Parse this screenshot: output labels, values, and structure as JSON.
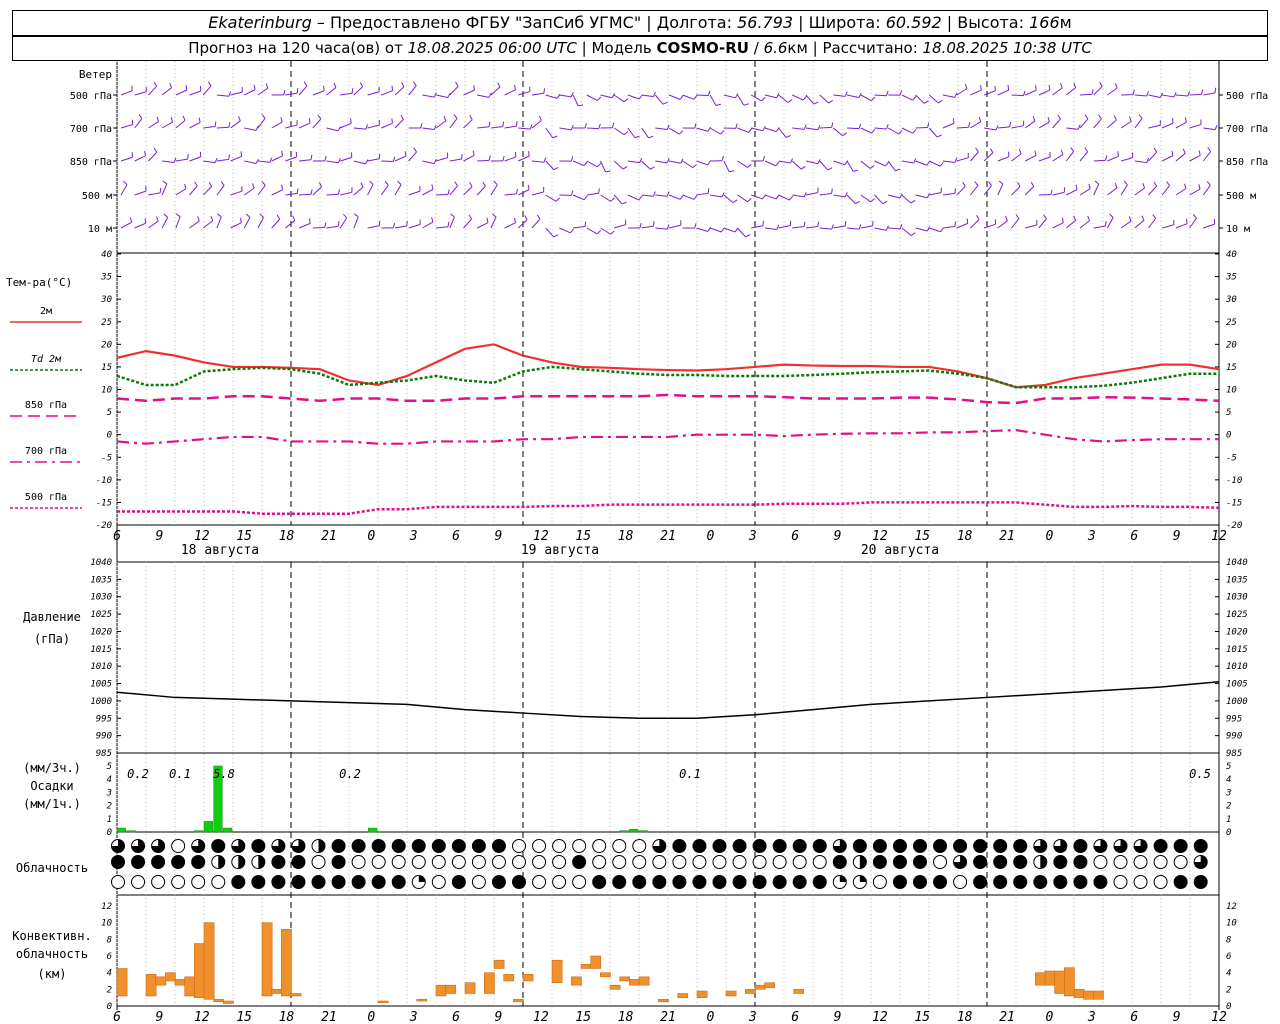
{
  "header": {
    "city": "Ekaterinburg",
    "dash": "–",
    "provider": "Предоставлено ФГБУ \"ЗапСиб УГМС\"",
    "lon_label": "Долгота:",
    "lon": "56.793",
    "lat_label": "Широта:",
    "lat": "60.592",
    "alt_label": "Высота:",
    "alt": "166",
    "alt_unit": "м",
    "forecast_prefix": "Прогноз на 120 часа(ов) от",
    "forecast_start": "18.08.2025 06:00 UTC",
    "model_label": "Модель",
    "model": "COSMO-RU",
    "model_res": "6.6",
    "model_res_unit": "км",
    "computed_label": "Рассчитано:",
    "computed": "18.08.2025 10:38 UTC",
    "sep": "|",
    "slash": "/"
  },
  "panels": {
    "wind": {
      "title": "Ветер",
      "levels": [
        "500 гПа",
        "700 гПа",
        "850 гПа",
        "500 м",
        "10 м"
      ],
      "color": "#7a1fd6"
    },
    "temp": {
      "title": "Тем-ра(°С)",
      "legend": [
        "2м",
        "Td 2м",
        "850 гПа",
        "700 гПа",
        "500 гПа"
      ],
      "yticks": [
        "40",
        "35",
        "30",
        "25",
        "20",
        "15",
        "10",
        "5",
        "0",
        "-5",
        "-10",
        "-15",
        "-20"
      ]
    },
    "pressure": {
      "title1": "Давление",
      "title2": "(гПа)",
      "yticks": [
        "1040",
        "1035",
        "1030",
        "1025",
        "1020",
        "1015",
        "1010",
        "1005",
        "1000",
        "995",
        "990",
        "985"
      ]
    },
    "precip": {
      "title1": "(мм/3ч.)",
      "title2": "Осадки",
      "title3": "(мм/1ч.)",
      "yticks": [
        "5",
        "4",
        "3",
        "2",
        "1",
        "0"
      ],
      "totals": [
        "0.2",
        "0.1",
        "5.8",
        "0.2",
        "0.1",
        "0.5"
      ]
    },
    "cloud": {
      "title": "Облачность"
    },
    "conv": {
      "title1": "Конвективн.",
      "title2": "облачность",
      "title3": "(км)",
      "yticks": [
        "12",
        "10",
        "8",
        "6",
        "4",
        "2",
        "0"
      ]
    }
  },
  "time_axis": {
    "hour_labels": [
      "6",
      "9",
      "12",
      "15",
      "18",
      "21",
      "0",
      "3",
      "6",
      "9",
      "12",
      "15",
      "18",
      "21",
      "0",
      "3",
      "6",
      "9",
      "12",
      "15",
      "18",
      "21",
      "0",
      "3",
      "6",
      "9",
      "12"
    ],
    "day_labels": [
      "18 августа",
      "19 августа",
      "20 августа"
    ]
  },
  "chart_data": {
    "type": "line",
    "x_unit": "hours since 18.08.2025 06:00 UTC",
    "temperature": {
      "ylim": [
        -20,
        40
      ],
      "series": [
        {
          "name": "2м",
          "color": "#f03030",
          "style": "solid",
          "x": [
            0,
            3,
            6,
            9,
            12,
            15,
            18,
            21,
            24,
            27,
            30,
            33,
            36,
            39,
            42,
            45,
            48,
            51,
            54,
            57,
            60,
            63,
            66,
            69,
            72,
            75,
            78,
            81,
            84,
            87,
            90,
            93,
            96,
            99,
            102,
            105,
            108,
            111,
            114
          ],
          "values": [
            17,
            18.5,
            17.5,
            16,
            15,
            15,
            14.8,
            14.5,
            12,
            11,
            13,
            16,
            19,
            20,
            17.5,
            16,
            15,
            14.8,
            14.5,
            14.3,
            14.2,
            14.5,
            15,
            15.5,
            15.3,
            15.2,
            15.2,
            15,
            15,
            14,
            12.5,
            10.5,
            11,
            12.5,
            13.5,
            14.5,
            15.5,
            15.5,
            14.5
          ]
        },
        {
          "name": "Td 2м",
          "color": "#0a7a0a",
          "style": "dot",
          "x": [
            0,
            3,
            6,
            9,
            12,
            15,
            18,
            21,
            24,
            27,
            30,
            33,
            36,
            39,
            42,
            45,
            48,
            51,
            54,
            57,
            60,
            63,
            66,
            69,
            72,
            75,
            78,
            81,
            84,
            87,
            90,
            93,
            96,
            99,
            102,
            105,
            108,
            111,
            114
          ],
          "values": [
            13,
            11,
            11,
            14,
            14.5,
            14.8,
            14.5,
            13.5,
            11,
            11.5,
            12,
            13,
            12,
            11.5,
            14,
            15,
            14.5,
            14,
            13.5,
            13.2,
            13.2,
            13,
            13,
            13,
            13.2,
            13.5,
            13.8,
            14,
            14.2,
            13.5,
            12.5,
            10.5,
            10.5,
            10.5,
            10.8,
            11.5,
            12.5,
            13.5,
            13.5
          ]
        },
        {
          "name": "850 гПа",
          "color": "#e0108a",
          "style": "dash",
          "x": [
            0,
            3,
            6,
            9,
            12,
            15,
            18,
            21,
            24,
            27,
            30,
            33,
            36,
            39,
            42,
            45,
            48,
            51,
            54,
            57,
            60,
            63,
            66,
            69,
            72,
            75,
            78,
            81,
            84,
            87,
            90,
            93,
            96,
            99,
            102,
            105,
            108,
            111,
            114
          ],
          "values": [
            8,
            7.5,
            8,
            8,
            8.5,
            8.5,
            8,
            7.5,
            8,
            8,
            7.5,
            7.5,
            8,
            8,
            8.5,
            8.5,
            8.5,
            8.5,
            8.5,
            8.8,
            8.5,
            8.5,
            8.5,
            8.3,
            8,
            8,
            8,
            8.2,
            8.2,
            7.8,
            7.2,
            7,
            8,
            8,
            8.3,
            8.2,
            8,
            7.8,
            7.5
          ]
        },
        {
          "name": "700 гПа",
          "color": "#e0108a",
          "style": "dashdot",
          "x": [
            0,
            3,
            6,
            9,
            12,
            15,
            18,
            21,
            24,
            27,
            30,
            33,
            36,
            39,
            42,
            45,
            48,
            51,
            54,
            57,
            60,
            63,
            66,
            69,
            72,
            75,
            78,
            81,
            84,
            87,
            90,
            93,
            96,
            99,
            102,
            105,
            108,
            111,
            114
          ],
          "values": [
            -1.5,
            -2,
            -1.5,
            -1,
            -0.5,
            -0.5,
            -1.5,
            -1.5,
            -1.5,
            -2,
            -2,
            -1.5,
            -1.5,
            -1.5,
            -1,
            -1,
            -0.5,
            -0.5,
            -0.5,
            -0.5,
            0,
            0,
            0,
            -0.3,
            0,
            0.2,
            0.3,
            0.3,
            0.5,
            0.5,
            0.8,
            1,
            0,
            -1,
            -1.5,
            -1.2,
            -1,
            -1,
            -1
          ]
        },
        {
          "name": "500 гПа",
          "color": "#e0108a",
          "style": "dot",
          "x": [
            0,
            3,
            6,
            9,
            12,
            15,
            18,
            21,
            24,
            27,
            30,
            33,
            36,
            39,
            42,
            45,
            48,
            51,
            54,
            57,
            60,
            63,
            66,
            69,
            72,
            75,
            78,
            81,
            84,
            87,
            90,
            93,
            96,
            99,
            102,
            105,
            108,
            111,
            114
          ],
          "values": [
            -17,
            -17,
            -17,
            -17,
            -17,
            -17.5,
            -17.5,
            -17.5,
            -17.5,
            -16.5,
            -16.5,
            -16,
            -16,
            -16,
            -16,
            -15.8,
            -15.8,
            -15.5,
            -15.5,
            -15.5,
            -15.5,
            -15.5,
            -15.5,
            -15.3,
            -15.3,
            -15.3,
            -15,
            -15,
            -15,
            -15,
            -15,
            -15,
            -15.5,
            -16,
            -16,
            -15.8,
            -16,
            -16,
            -16.2
          ]
        }
      ]
    },
    "pressure": {
      "ylim": [
        985,
        1040
      ],
      "series": [
        {
          "name": "p",
          "color": "#000000",
          "x": [
            0,
            6,
            12,
            18,
            24,
            30,
            36,
            42,
            48,
            54,
            60,
            66,
            72,
            78,
            84,
            90,
            96,
            102,
            108,
            114
          ],
          "values": [
            1002.5,
            1001,
            1000.5,
            1000,
            999.5,
            999,
            997.5,
            996.5,
            995.5,
            995,
            995,
            996,
            997.5,
            999,
            1000,
            1001,
            1002,
            1003,
            1004,
            1005.5
          ]
        }
      ]
    },
    "precip": {
      "ylim": [
        0,
        5
      ],
      "color": "#11cc11",
      "x": [
        0,
        1,
        2,
        3,
        6,
        7,
        8,
        9,
        10,
        11,
        12,
        13,
        14,
        24,
        25,
        26,
        27,
        28,
        29,
        30,
        31,
        32,
        33,
        34,
        35,
        36,
        37,
        38,
        39,
        40,
        41,
        42,
        43,
        44,
        45,
        46,
        47,
        48,
        49,
        50,
        51,
        52,
        53,
        54,
        55,
        56,
        57,
        58,
        59,
        60,
        61,
        62,
        63,
        64,
        65,
        66,
        67,
        68,
        69,
        70,
        71,
        72,
        73,
        74,
        75,
        76,
        77,
        78,
        79,
        80,
        81,
        82,
        83,
        84,
        85,
        86,
        87,
        88,
        89,
        90,
        91,
        92,
        93,
        94,
        95,
        96,
        97,
        98,
        99,
        100,
        101,
        102,
        103,
        104,
        105,
        106,
        107,
        108,
        109,
        110,
        111,
        112,
        113,
        114
      ],
      "values": [
        0.3,
        0.1,
        0,
        0,
        0,
        0,
        0.1,
        0.8,
        5,
        0.3,
        0,
        0,
        0,
        0,
        0,
        0.3,
        0,
        0,
        0,
        0,
        0,
        0,
        0,
        0,
        0,
        0,
        0,
        0,
        0,
        0,
        0,
        0,
        0,
        0,
        0,
        0,
        0,
        0,
        0,
        0,
        0,
        0.1,
        0.2,
        0.1,
        0,
        0,
        0,
        0,
        0,
        0,
        0,
        0,
        0,
        0,
        0,
        0,
        0,
        0,
        0,
        0,
        0,
        0,
        0,
        0,
        0,
        0,
        0,
        0,
        0,
        0,
        0,
        0,
        0,
        0,
        0,
        0,
        0,
        0,
        0,
        0,
        0,
        0,
        0,
        0,
        0,
        0,
        0,
        0,
        0,
        0,
        0,
        0,
        0,
        0,
        0,
        0,
        0,
        0,
        0,
        0,
        0,
        0,
        0,
        0,
        0,
        0,
        0,
        0,
        0,
        0,
        0,
        0.6,
        0.1,
        0,
        0
      ]
    },
    "convective_cloud": {
      "ylim": [
        0,
        12
      ],
      "color": "#f0902a",
      "bars": [
        {
          "x": 0,
          "base": 1.2,
          "top": 4.5
        },
        {
          "x": 3,
          "base": 1.2,
          "top": 3.8
        },
        {
          "x": 4,
          "base": 2.5,
          "top": 3.5
        },
        {
          "x": 5,
          "base": 3,
          "top": 4
        },
        {
          "x": 6,
          "base": 2.5,
          "top": 3.2
        },
        {
          "x": 7,
          "base": 1.2,
          "top": 3.5
        },
        {
          "x": 8,
          "base": 1,
          "top": 7.5
        },
        {
          "x": 9,
          "base": 0.8,
          "top": 10
        },
        {
          "x": 10,
          "base": 0.5,
          "top": 0.8
        },
        {
          "x": 11,
          "base": 0.3,
          "top": 0.6
        },
        {
          "x": 15,
          "base": 1.2,
          "top": 10
        },
        {
          "x": 16,
          "base": 1.5,
          "top": 2
        },
        {
          "x": 17,
          "base": 1.2,
          "top": 9.2
        },
        {
          "x": 18,
          "base": 1.2,
          "top": 1.5
        },
        {
          "x": 27,
          "base": 0.4,
          "top": 0.6
        },
        {
          "x": 31,
          "base": 0.6,
          "top": 0.8
        },
        {
          "x": 33,
          "base": 1.2,
          "top": 2.5
        },
        {
          "x": 34,
          "base": 1.5,
          "top": 2.5
        },
        {
          "x": 36,
          "base": 1.5,
          "top": 2.8
        },
        {
          "x": 38,
          "base": 1.5,
          "top": 4
        },
        {
          "x": 39,
          "base": 4.5,
          "top": 5.5
        },
        {
          "x": 40,
          "base": 3,
          "top": 3.8
        },
        {
          "x": 41,
          "base": 0.5,
          "top": 0.8
        },
        {
          "x": 42,
          "base": 3,
          "top": 3.8
        },
        {
          "x": 45,
          "base": 2.8,
          "top": 5.5
        },
        {
          "x": 47,
          "base": 2.5,
          "top": 3.5
        },
        {
          "x": 48,
          "base": 4.5,
          "top": 5
        },
        {
          "x": 49,
          "base": 4.5,
          "top": 6
        },
        {
          "x": 50,
          "base": 3.5,
          "top": 4
        },
        {
          "x": 51,
          "base": 2,
          "top": 2.5
        },
        {
          "x": 52,
          "base": 3,
          "top": 3.5
        },
        {
          "x": 53,
          "base": 2.5,
          "top": 3.2
        },
        {
          "x": 54,
          "base": 2.5,
          "top": 3.5
        },
        {
          "x": 56,
          "base": 0.5,
          "top": 0.8
        },
        {
          "x": 58,
          "base": 1,
          "top": 1.5
        },
        {
          "x": 60,
          "base": 1,
          "top": 1.8
        },
        {
          "x": 63,
          "base": 1.2,
          "top": 1.8
        },
        {
          "x": 65,
          "base": 1.5,
          "top": 2
        },
        {
          "x": 66,
          "base": 2,
          "top": 2.5
        },
        {
          "x": 67,
          "base": 2.2,
          "top": 2.8
        },
        {
          "x": 70,
          "base": 1.5,
          "top": 2
        },
        {
          "x": 95,
          "base": 2.5,
          "top": 4
        },
        {
          "x": 96,
          "base": 2.5,
          "top": 4.2
        },
        {
          "x": 97,
          "base": 1.5,
          "top": 4.2
        },
        {
          "x": 98,
          "base": 1.2,
          "top": 4.6
        },
        {
          "x": 99,
          "base": 1,
          "top": 2
        },
        {
          "x": 100,
          "base": 0.8,
          "top": 1.8
        },
        {
          "x": 101,
          "base": 0.8,
          "top": 1.8
        }
      ]
    },
    "cloudiness_rows": [
      "3330323233422222222200000003222222223222222222332333222222222200000000320000003003000000222222",
      "2222244422020000000000020000000000002422203222422000003333000032400000000002330000020302220",
      "0000002222222221020220002222222222221102220222222200022222220000000000022000020000022222222222"
    ],
    "cloud_legend": {
      "0": "clear",
      "1": "quarter",
      "2": "overcast",
      "3": "mostly",
      "4": "half"
    }
  }
}
